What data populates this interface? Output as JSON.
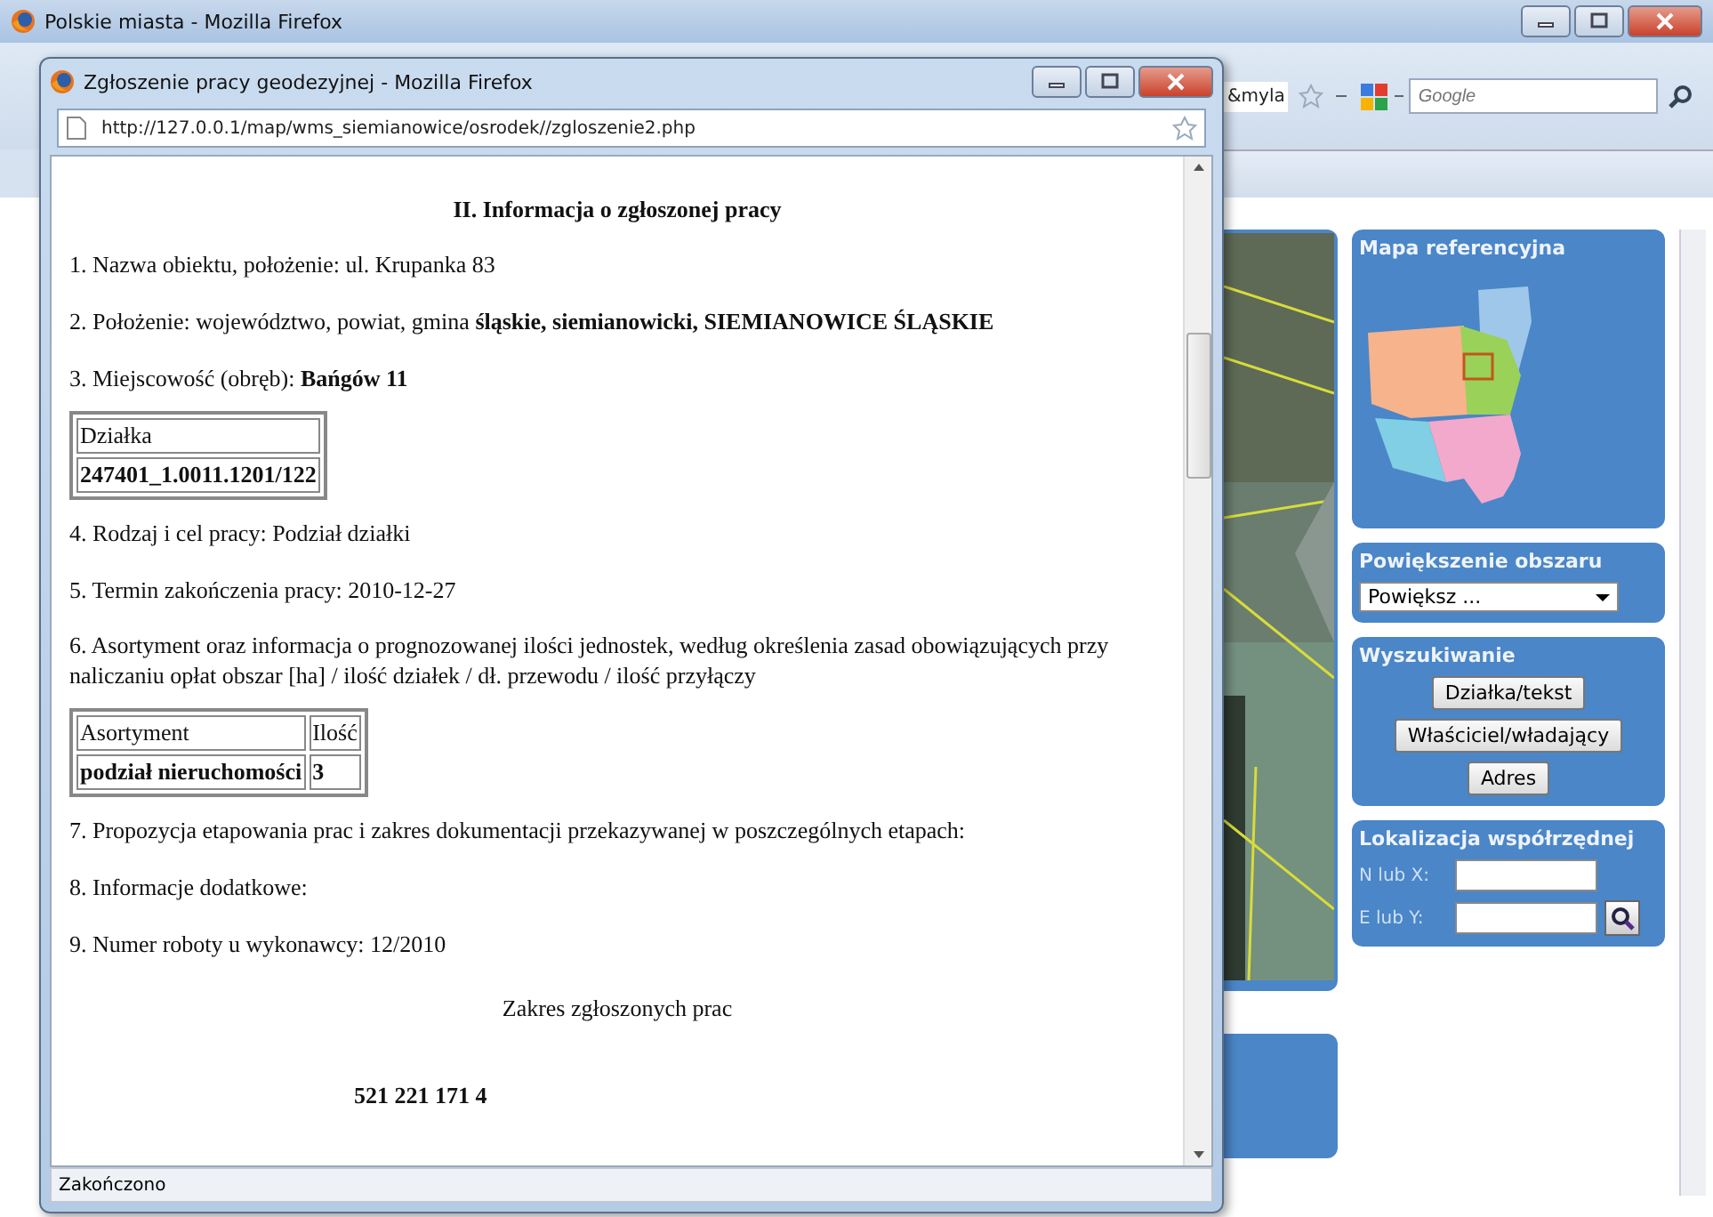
{
  "main_window": {
    "title": "Polskie miasta - Mozilla Firefox",
    "address_tail": "&myla",
    "search": {
      "placeholder": "Google"
    },
    "panels": [
      {
        "kind": "map",
        "title": "Mapa referencyjna"
      },
      {
        "kind": "select",
        "title": "Powiększenie obszaru",
        "value": "Powiększ ..."
      },
      {
        "kind": "buttons",
        "title": "Wyszukiwanie",
        "buttons": [
          "Działka/tekst",
          "Właściciel/władający",
          "Adres"
        ]
      },
      {
        "kind": "coords",
        "title": "Lokalizacja współrzędnej",
        "fields": [
          {
            "label": "N lub X:"
          },
          {
            "label": "E lub Y:"
          }
        ]
      }
    ]
  },
  "popup": {
    "title": "Zgłoszenie pracy geodezyjnej - Mozilla Firefox",
    "url": "http://127.0.0.1/map/wms_siemianowice/osrodek//zgloszenie2.php",
    "content": [
      {
        "kind": "heading",
        "text": "II. Informacja o zgłoszonej pracy"
      },
      {
        "kind": "para",
        "text": "1. Nazwa obiektu, położenie: ul. Krupanka 83"
      },
      {
        "kind": "para",
        "text": "2. Położenie: województwo, powiat, gmina **śląskie, siemianowicki, SIEMIANOWICE ŚLĄSKIE**"
      },
      {
        "kind": "para",
        "text": "3. Miejscowość (obręb): **Bańgów 11**"
      },
      {
        "kind": "table",
        "columns": [
          "Działka"
        ],
        "rows": [
          [
            "247401_1.0011.1201/122"
          ]
        ]
      },
      {
        "kind": "para",
        "text": "4. Rodzaj i cel pracy: Podział działki"
      },
      {
        "kind": "para",
        "text": "5. Termin zakończenia pracy: 2010-12-27"
      },
      {
        "kind": "para",
        "text": "6. Asortyment oraz informacja o prognozowanej ilości jednostek, według określenia zasad obowiązujących przy naliczaniu opłat obszar [ha] / ilość działek / dł. przewodu / ilość przyłączy"
      },
      {
        "kind": "table",
        "columns": [
          "Asortyment",
          "Ilość"
        ],
        "rows": [
          [
            "podział nieruchomości",
            "3"
          ]
        ]
      },
      {
        "kind": "para",
        "text": "7. Propozycja etapowania prac i zakres dokumentacji przekazywanej w poszczególnych etapach:"
      },
      {
        "kind": "para",
        "text": "8. Informacje dodatkowe:"
      },
      {
        "kind": "para",
        "text": "9. Numer roboty u wykonawcy: 12/2010"
      },
      {
        "kind": "heading2",
        "text": "Zakres zgłoszonych prac"
      },
      {
        "kind": "code",
        "text": "521 221 171 4"
      }
    ],
    "status_bar": "Zakończono"
  }
}
